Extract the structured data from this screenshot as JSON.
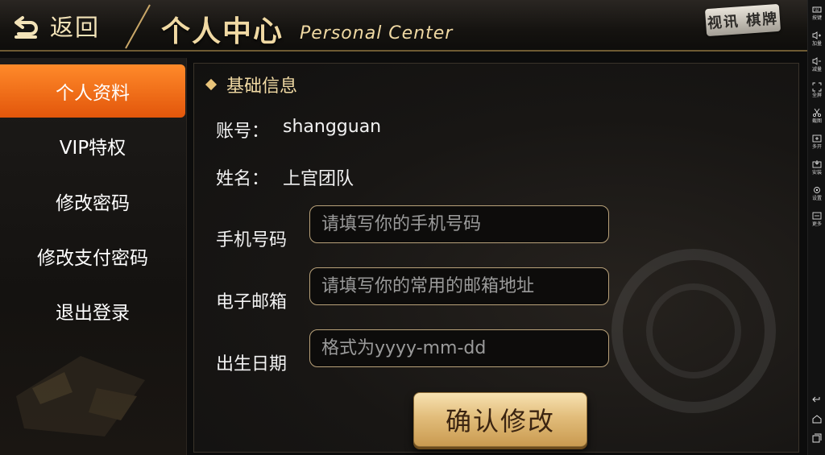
{
  "header": {
    "back_label": "返回",
    "title": "个人中心",
    "subtitle": "Personal Center",
    "brand": "视讯 棋牌"
  },
  "sidebar": {
    "items": [
      {
        "label": "个人资料",
        "active": true
      },
      {
        "label": "VIP特权",
        "active": false
      },
      {
        "label": "修改密码",
        "active": false
      },
      {
        "label": "修改支付密码",
        "active": false
      },
      {
        "label": "退出登录",
        "active": false
      }
    ]
  },
  "main": {
    "section_title": "基础信息",
    "account": {
      "label": "账号：",
      "value": "shangguan"
    },
    "name": {
      "label": "姓名：",
      "value": "上官团队"
    },
    "phone": {
      "label": "手机号码",
      "placeholder": "请填写你的手机号码",
      "value": ""
    },
    "email": {
      "label": "电子邮箱",
      "placeholder": "请填写你的常用的邮箱地址",
      "value": ""
    },
    "birthday": {
      "label": "出生日期",
      "placeholder": "格式为yyyy-mm-dd",
      "value": ""
    },
    "confirm_label": "确认修改"
  },
  "sys_toolbar": {
    "items": [
      {
        "label": "按键",
        "icon": "keyboard-icon"
      },
      {
        "label": "加量",
        "icon": "volume-up-icon"
      },
      {
        "label": "减量",
        "icon": "volume-down-icon"
      },
      {
        "label": "全屏",
        "icon": "fullscreen-icon"
      },
      {
        "label": "截图",
        "icon": "scissors-icon"
      },
      {
        "label": "多开",
        "icon": "multi-open-icon"
      },
      {
        "label": "安装",
        "icon": "install-icon"
      },
      {
        "label": "设置",
        "icon": "gear-icon"
      },
      {
        "label": "更多",
        "icon": "more-icon"
      }
    ],
    "nav": [
      "back-nav-icon",
      "home-nav-icon",
      "recent-apps-icon"
    ]
  },
  "colors": {
    "accent_orange": "#ff8a2a",
    "gold": "#f0d9a3",
    "button_gold": "#e2bd7b"
  }
}
